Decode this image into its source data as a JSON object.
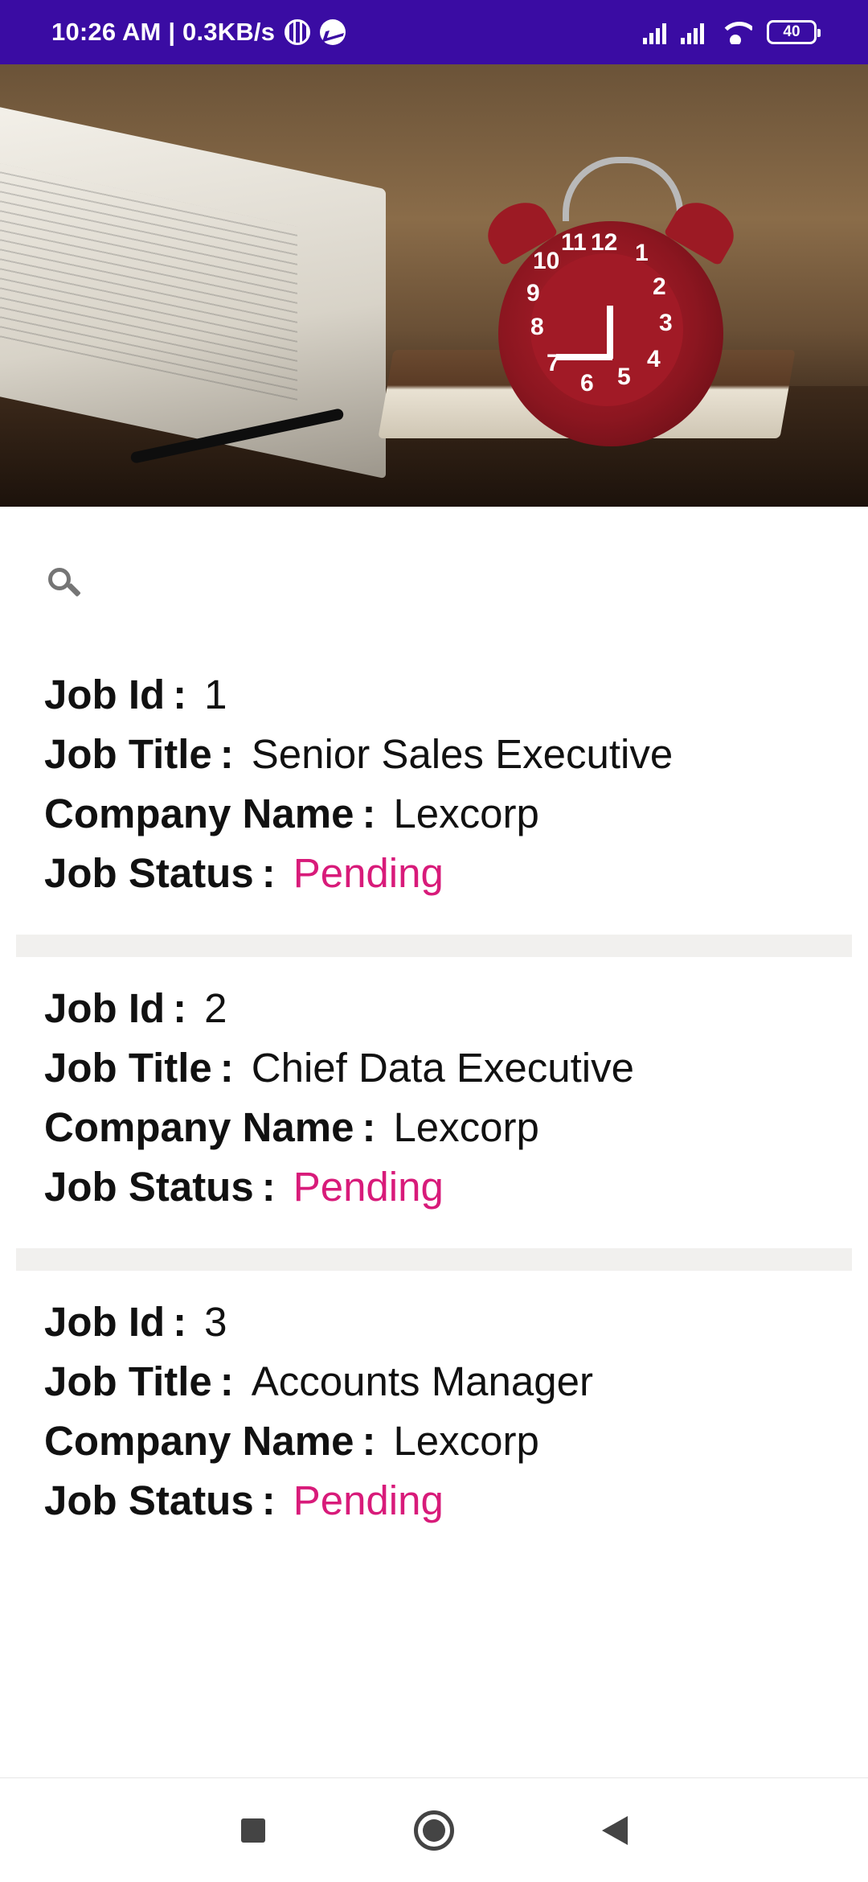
{
  "status_bar": {
    "time_and_speed": "10:26 AM | 0.3KB/s",
    "battery_level": "40",
    "icons": [
      "globe-icon",
      "messenger-icon",
      "signal-icon",
      "signal-icon",
      "wifi-icon",
      "battery-icon"
    ]
  },
  "hero": {
    "icon": "hero-image",
    "clock_numbers": [
      "12",
      "1",
      "2",
      "3",
      "4",
      "5",
      "6",
      "7",
      "8",
      "9",
      "10",
      "11"
    ]
  },
  "search": {
    "icon": "search-icon"
  },
  "jobs": [
    {
      "id_label": "Job Id",
      "id_value": "1",
      "title_label": "Job Title",
      "title_value": "Senior Sales Executive",
      "company_label": "Company Name",
      "company_value": "Lexcorp",
      "status_label": "Job Status",
      "status_value": "Pending"
    },
    {
      "id_label": "Job Id",
      "id_value": "2",
      "title_label": "Job Title",
      "title_value": "Chief Data Executive",
      "company_label": "Company Name",
      "company_value": "Lexcorp",
      "status_label": "Job Status",
      "status_value": "Pending"
    },
    {
      "id_label": "Job Id",
      "id_value": "3",
      "title_label": "Job Title",
      "title_value": "Accounts Manager",
      "company_label": "Company Name",
      "company_value": "Lexcorp",
      "status_label": "Job Status",
      "status_value": "Pending"
    }
  ],
  "colon": ":",
  "colors": {
    "status_bar": "#3a0ca3",
    "status_pending": "#d81b7a",
    "separator": "#f1f0ee"
  },
  "nav_bar": {
    "icons": [
      "recent-apps-icon",
      "home-icon",
      "back-icon"
    ]
  }
}
